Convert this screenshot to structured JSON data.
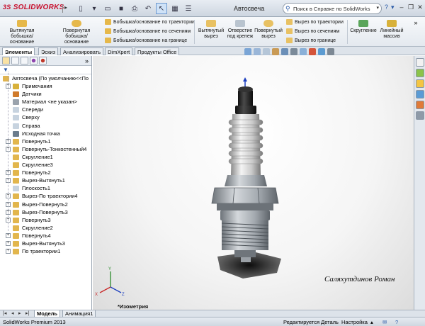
{
  "app": {
    "logo_brand": "SOLIDWORKS",
    "logo_ds": "3S",
    "document_title": "Автосвеча"
  },
  "search": {
    "placeholder": "Поиск в Справке по SolidWorks"
  },
  "ribbon": {
    "extruded_boss": "Вытянутая бобышка/основание",
    "revolved_boss": "Повернутая бобышка/основание",
    "swept_boss": "Бобышка/основание по траектории",
    "lofted_boss": "Бобышка/основание по сечениям",
    "boundary_boss": "Бобышка/основание на границе",
    "extruded_cut": "Вытянутый вырез",
    "hole_wizard": "Отверстие под крепеж",
    "revolved_cut": "Повернутый вырез",
    "swept_cut": "Вырез по траектории",
    "lofted_cut": "Вырез по сечениям",
    "boundary_cut": "Вырез по границе",
    "fillet": "Скругление",
    "linear_pattern": "Линейный массив"
  },
  "cm_tabs": [
    "Элементы",
    "Эскиз",
    "Анализировать",
    "DimXpert",
    "Продукты Office"
  ],
  "tree": {
    "root": "Автосвеча  (По умолчанию<<По",
    "items": [
      {
        "label": "Примечания",
        "expandable": true,
        "color": "#d8b13a"
      },
      {
        "label": "Датчики",
        "expandable": false,
        "color": "#d07b2c"
      },
      {
        "label": "Материал <не указан>",
        "expandable": false,
        "color": "#9aa3ad"
      },
      {
        "label": "Спереди",
        "expandable": false,
        "color": "#c7d3df"
      },
      {
        "label": "Сверху",
        "expandable": false,
        "color": "#c7d3df"
      },
      {
        "label": "Справа",
        "expandable": false,
        "color": "#c7d3df"
      },
      {
        "label": "Исходная точка",
        "expandable": false,
        "color": "#6b7c8c"
      },
      {
        "label": "Повернуть1",
        "expandable": true,
        "color": "#e2b64d"
      },
      {
        "label": "Повернуть-Тонкостенный4",
        "expandable": true,
        "color": "#e2b64d"
      },
      {
        "label": "Скругление1",
        "expandable": false,
        "color": "#e2b64d"
      },
      {
        "label": "Скругление3",
        "expandable": false,
        "color": "#e2b64d"
      },
      {
        "label": "Повернуть2",
        "expandable": true,
        "color": "#e2b64d"
      },
      {
        "label": "Вырез-Вытянуть1",
        "expandable": true,
        "color": "#e2b64d"
      },
      {
        "label": "Плоскость1",
        "expandable": false,
        "color": "#c7d3df"
      },
      {
        "label": "Вырез-По траектории4",
        "expandable": true,
        "color": "#e2b64d"
      },
      {
        "label": "Вырез-Повернуть2",
        "expandable": true,
        "color": "#e2b64d"
      },
      {
        "label": "Вырез-Повернуть3",
        "expandable": true,
        "color": "#e2b64d"
      },
      {
        "label": "Повернуть3",
        "expandable": true,
        "color": "#e2b64d"
      },
      {
        "label": "Скругление2",
        "expandable": false,
        "color": "#e2b64d"
      },
      {
        "label": "Повернуть4",
        "expandable": true,
        "color": "#e2b64d"
      },
      {
        "label": "Вырез-Вытянуть3",
        "expandable": true,
        "color": "#e2b64d"
      },
      {
        "label": "По траектории1",
        "expandable": true,
        "color": "#e2b64d"
      }
    ]
  },
  "viewport": {
    "author": "Саляхутдинов Роман",
    "view_name": "*Изометрия"
  },
  "bottom_tabs": [
    "Модель",
    "Анимация1"
  ],
  "status": {
    "product": "SolidWorks Premium 2013",
    "mode": "Редактируется Деталь",
    "settings": "Настройка"
  },
  "colors": {
    "accent": "#c8102e",
    "ceramic": "#d9d9d9",
    "metal": "#9ea4aa",
    "terminal": "#2a2a2a"
  }
}
